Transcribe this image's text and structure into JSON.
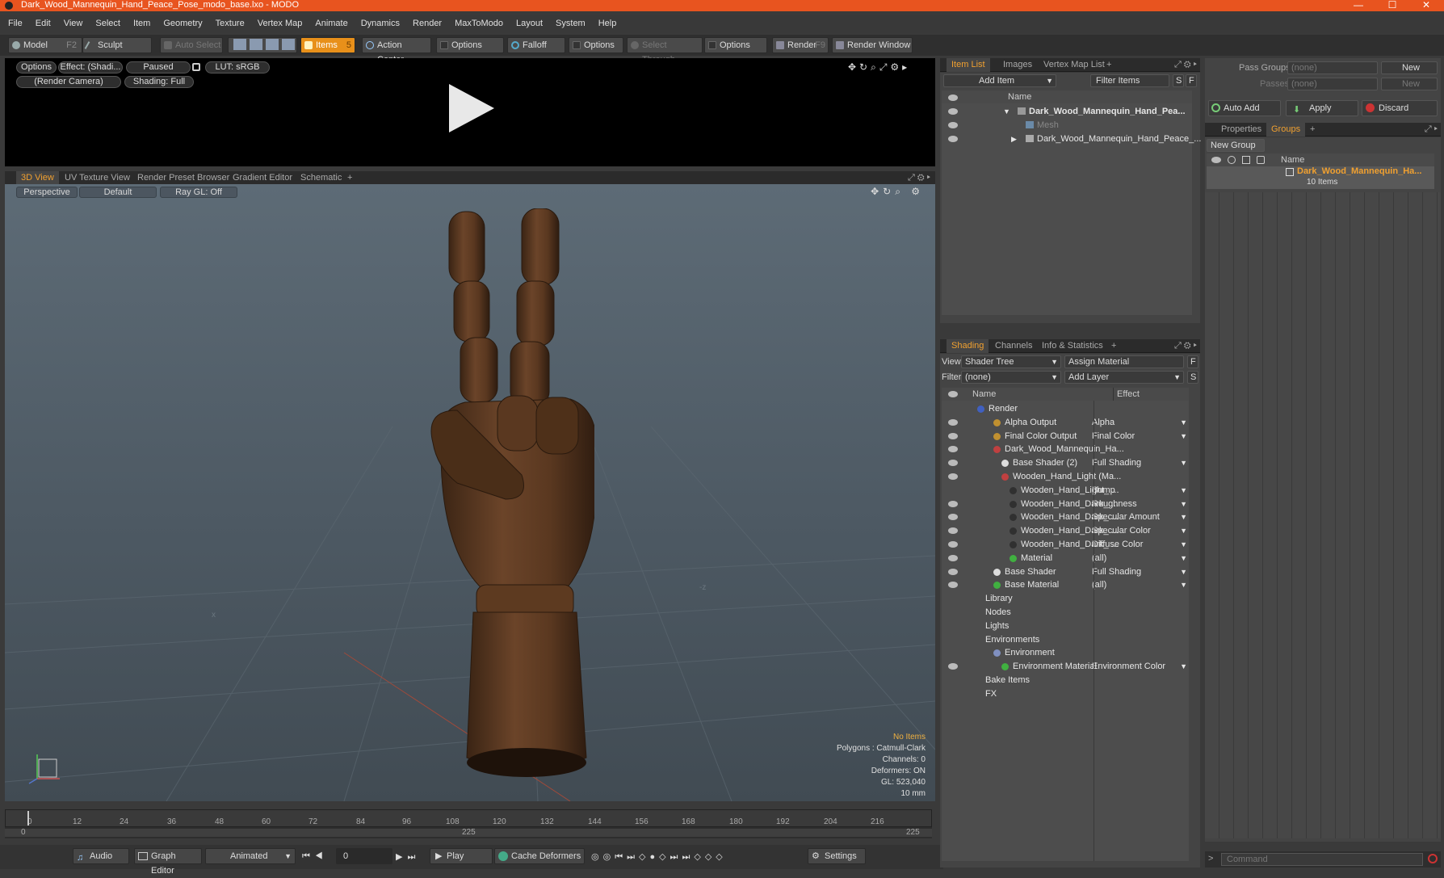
{
  "window": {
    "title": "Dark_Wood_Mannequin_Hand_Peace_Pose_modo_base.lxo - MODO",
    "min": "—",
    "max": "☐",
    "close": "✕"
  },
  "menu": [
    "File",
    "Edit",
    "View",
    "Select",
    "Item",
    "Geometry",
    "Texture",
    "Vertex Map",
    "Animate",
    "Dynamics",
    "Render",
    "MaxToModo",
    "Layout",
    "System",
    "Help"
  ],
  "toolbar": {
    "model": "Model",
    "model_key": "F2",
    "sculpt": "Sculpt",
    "auto_select": "Auto Select",
    "items": "Items",
    "items_key": "5",
    "action_center": "Action Center",
    "options1": "Options",
    "falloff": "Falloff",
    "options2": "Options",
    "select_through": "Select Through",
    "options3": "Options",
    "render": "Render",
    "render_key": "F9",
    "render_window": "Render Window"
  },
  "preview": {
    "options": "Options",
    "effect": "Effect: (Shadi...",
    "paused": "Paused",
    "lut": "LUT: sRGB",
    "camera": "(Render Camera)",
    "shading": "Shading: Full"
  },
  "viewport_tabs": [
    "3D View",
    "UV Texture View",
    "Render Preset Browser",
    "Gradient Editor",
    "Schematic",
    "+"
  ],
  "viewport": {
    "perspective": "Perspective",
    "default": "Default",
    "raygl": "Ray GL: Off",
    "info": [
      "No Items",
      "Polygons : Catmull-Clark",
      "Channels: 0",
      "Deformers: ON",
      "GL: 523,040",
      "10 mm"
    ],
    "axis_x": "x",
    "axis_z": "-z"
  },
  "timeline": {
    "ticks": [
      "0",
      "12",
      "24",
      "36",
      "48",
      "60",
      "72",
      "84",
      "96",
      "108",
      "120",
      "132",
      "144",
      "156",
      "168",
      "180",
      "192",
      "204",
      "216"
    ],
    "start": "0",
    "mid": "225",
    "end": "225"
  },
  "bottom": {
    "audio": "Audio",
    "graph_editor": "Graph Editor",
    "animated": "Animated",
    "frame": "0",
    "play": "Play",
    "cache_deformers": "Cache Deformers",
    "settings": "Settings"
  },
  "item_list": {
    "tabs": [
      "Item List",
      "Images",
      "Vertex Map List",
      "+"
    ],
    "add_item": "Add Item",
    "filter": "Filter Items",
    "s": "S",
    "f": "F",
    "name_col": "Name",
    "rows": [
      {
        "label": "Dark_Wood_Mannequin_Hand_Pea...",
        "indent": 0,
        "bold": true
      },
      {
        "label": "Mesh",
        "indent": 1,
        "dim": true
      },
      {
        "label": "Dark_Wood_Mannequin_Hand_Peace_...",
        "indent": 1
      }
    ]
  },
  "shading": {
    "tabs": [
      "Shading",
      "Channels",
      "Info & Statistics",
      "+"
    ],
    "view_label": "View",
    "view_value": "Shader Tree",
    "assign_material": "Assign Material",
    "f": "F",
    "filter_label": "Filter",
    "filter_value": "(none)",
    "add_layer": "Add Layer",
    "s": "S",
    "name_col": "Name",
    "effect_col": "Effect",
    "rows": [
      {
        "label": "Render",
        "effect": "",
        "indent": 0,
        "eye": false,
        "ball": "#4060c0"
      },
      {
        "label": "Alpha Output",
        "effect": "Alpha",
        "indent": 2,
        "eye": true,
        "ball": "#c09030"
      },
      {
        "label": "Final Color Output",
        "effect": "Final Color",
        "indent": 2,
        "eye": true,
        "ball": "#c09030"
      },
      {
        "label": "Dark_Wood_Mannequin_Ha...",
        "effect": "",
        "indent": 2,
        "eye": true,
        "ball": "#c04040"
      },
      {
        "label": "Base Shader (2)",
        "effect": "Full Shading",
        "indent": 3,
        "eye": true,
        "ball": "#dddddd"
      },
      {
        "label": "Wooden_Hand_Light (Ma...",
        "effect": "",
        "indent": 3,
        "eye": true,
        "ball": "#c04040"
      },
      {
        "label": "Wooden_Hand_Light_ ...",
        "effect": "Bump",
        "indent": 4,
        "eye": false,
        "ball": "#303030"
      },
      {
        "label": "Wooden_Hand_Dark_ ...",
        "effect": "Roughness",
        "indent": 4,
        "eye": true,
        "ball": "#303030"
      },
      {
        "label": "Wooden_Hand_Dark_ ...",
        "effect": "Specular Amount",
        "indent": 4,
        "eye": true,
        "ball": "#303030"
      },
      {
        "label": "Wooden_Hand_Dark_ ...",
        "effect": "Specular Color",
        "indent": 4,
        "eye": true,
        "ball": "#303030"
      },
      {
        "label": "Wooden_Hand_Dark_ ...",
        "effect": "Diffuse Color",
        "indent": 4,
        "eye": true,
        "ball": "#303030"
      },
      {
        "label": "Material",
        "effect": "(all)",
        "indent": 4,
        "eye": true,
        "ball": "#40b040"
      },
      {
        "label": "Base Shader",
        "effect": "Full Shading",
        "indent": 2,
        "eye": true,
        "ball": "#dddddd"
      },
      {
        "label": "Base Material",
        "effect": "(all)",
        "indent": 2,
        "eye": true,
        "ball": "#40b040"
      },
      {
        "label": "Library",
        "effect": "",
        "indent": 1,
        "eye": false,
        "ball": ""
      },
      {
        "label": "Nodes",
        "effect": "",
        "indent": 1,
        "eye": false,
        "ball": ""
      },
      {
        "label": "Lights",
        "effect": "",
        "indent": 1,
        "eye": false,
        "ball": ""
      },
      {
        "label": "Environments",
        "effect": "",
        "indent": 1,
        "eye": false,
        "ball": ""
      },
      {
        "label": "Environment",
        "effect": "",
        "indent": 2,
        "eye": false,
        "ball": "#8090c0"
      },
      {
        "label": "Environment Material",
        "effect": "Environment Color",
        "indent": 3,
        "eye": true,
        "ball": "#40b040"
      },
      {
        "label": "Bake Items",
        "effect": "",
        "indent": 1,
        "eye": false,
        "ball": ""
      },
      {
        "label": "FX",
        "effect": "",
        "indent": 1,
        "eye": false,
        "ball": ""
      }
    ]
  },
  "groups": {
    "pass_groups_label": "Pass Groups",
    "pass_groups_value": "(none)",
    "new": "New",
    "passes_label": "Passes",
    "passes_value": "(none)",
    "new2": "New",
    "auto_add": "Auto Add",
    "apply": "Apply",
    "discard": "Discard",
    "tabs": [
      "Properties",
      "Groups",
      "+"
    ],
    "new_group": "New Group",
    "name_col": "Name",
    "item": "Dark_Wood_Mannequin_Ha...",
    "item_count": "10 Items"
  },
  "command": {
    "placeholder": "Command"
  },
  "colors": {
    "accent": "#f0a030",
    "title_bar": "#e8541f"
  }
}
